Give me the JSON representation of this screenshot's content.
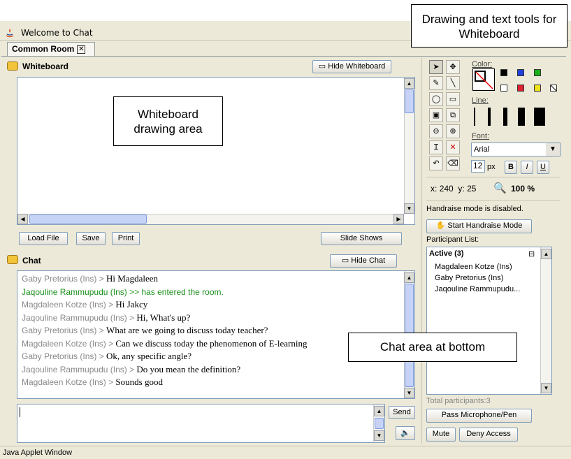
{
  "window": {
    "title": "Welcome to Chat",
    "tab_label": "Common Room",
    "status": "Java Applet Window"
  },
  "whiteboard": {
    "heading": "Whiteboard",
    "hide_label": "Hide Whiteboard",
    "buttons": {
      "load": "Load File",
      "save": "Save",
      "print": "Print",
      "slides": "Slide Shows"
    }
  },
  "chat": {
    "heading": "Chat",
    "hide_label": "Hide Chat",
    "messages": [
      {
        "name": "Gaby Pretorius (Ins)",
        "sep": " > ",
        "text": "Hi Magdaleen"
      },
      {
        "name": "Jaqouline Rammupudu (Ins)",
        "sep": " >> ",
        "text": "has entered the room."
      },
      {
        "name": "Magdaleen Kotze (Ins)",
        "sep": " > ",
        "text": "Hi Jakcy"
      },
      {
        "name": "Jaqouline Rammupudu (Ins)",
        "sep": " > ",
        "text": "Hi, What's up?"
      },
      {
        "name": "Gaby Pretorius (Ins)",
        "sep": " > ",
        "text": "What are we going to discuss today teacher?"
      },
      {
        "name": "Magdaleen Kotze (Ins)",
        "sep": " > ",
        "text": "Can we discuss today the phenomenon of E-learning"
      },
      {
        "name": "Gaby Pretorius (Ins)",
        "sep": " > ",
        "text": "Ok, any specific angle?"
      },
      {
        "name": "Jaqouline Rammupudu (Ins)",
        "sep": " > ",
        "text": "Do you mean the definition?"
      },
      {
        "name": "Magdaleen Kotze (Ins)",
        "sep": " > ",
        "text": "Sounds good"
      }
    ],
    "send_label": "Send"
  },
  "tools": {
    "color_label": "Color:",
    "line_label": "Line:",
    "font_label": "Font:",
    "font_value": "Arial",
    "size_value": "12",
    "size_unit": "px",
    "bold": "B",
    "italic": "I",
    "underline": "U",
    "x_label": "x:",
    "x_value": "240",
    "y_label": "y:",
    "y_value": "25",
    "zoom_value": "100 %",
    "colors": [
      "#000000",
      "#1f3fe0",
      "#1bb01b",
      "#ffffff",
      "#e01f2f",
      "#f2e21a"
    ]
  },
  "participants": {
    "handraise_status": "Handraise mode is disabled.",
    "handraise_button": "Start Handraise Mode",
    "list_label": "Participant List:",
    "active_header": "Active (3)",
    "names": [
      "Magdaleen Kotze (Ins)",
      "Gaby Pretorius (Ins)",
      "Jaqouline Rammupudu..."
    ],
    "total": "Total participants:3",
    "pass_button": "Pass Microphone/Pen",
    "mute_button": "Mute",
    "deny_button": "Deny Access"
  },
  "annotations": {
    "tools_callout": "Drawing and text tools for Whiteboard",
    "whiteboard_callout": "Whiteboard drawing area",
    "chat_callout": "Chat area at bottom"
  }
}
